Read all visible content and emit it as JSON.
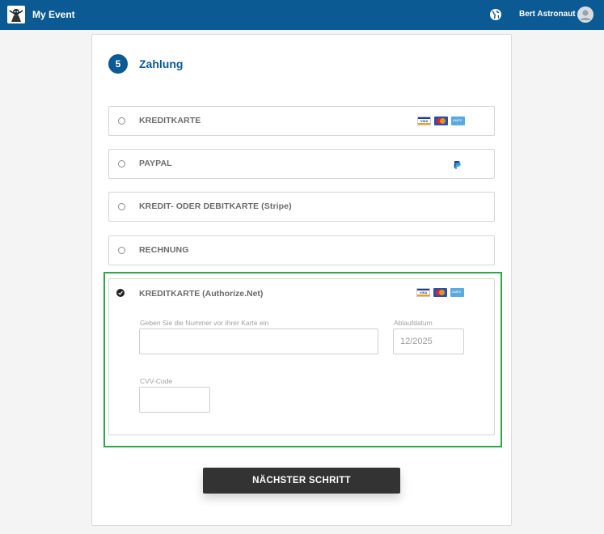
{
  "header": {
    "app_title": "My Event",
    "user_name": "Bert Astronaut",
    "brand_color": "#0b5a93"
  },
  "step": {
    "number": "5",
    "title": "Zahlung"
  },
  "payment_options": [
    {
      "label": "KREDITKARTE",
      "icons": [
        "visa-card-icon",
        "mastercard-icon",
        "amex-card-icon"
      ]
    },
    {
      "label": "PAYPAL",
      "icons": [
        "paypal-icon"
      ]
    },
    {
      "label": "KREDIT- ODER DEBITKARTE (Stripe)",
      "icons": []
    },
    {
      "label": "RECHNUNG",
      "icons": []
    }
  ],
  "selected_option": {
    "label": "KREDITKARTE (Authorize.Net)",
    "icons": [
      "visa-card-icon",
      "mastercard-icon",
      "amex-card-icon"
    ],
    "card_number_label": "Geben Sie die Nummer vor Ihrer Karte ein",
    "card_number_value": "",
    "expiry_label": "Ablaufdatum",
    "expiry_placeholder": "12/2025",
    "cvv_label": "CVV-Code",
    "cvv_value": ""
  },
  "card_icons": {
    "visa": "VISA",
    "amex": "AMEX"
  },
  "actions": {
    "next_label": "NÄCHSTER SCHRITT"
  },
  "colors": {
    "highlight": "#2ea74a",
    "button": "#333333"
  }
}
